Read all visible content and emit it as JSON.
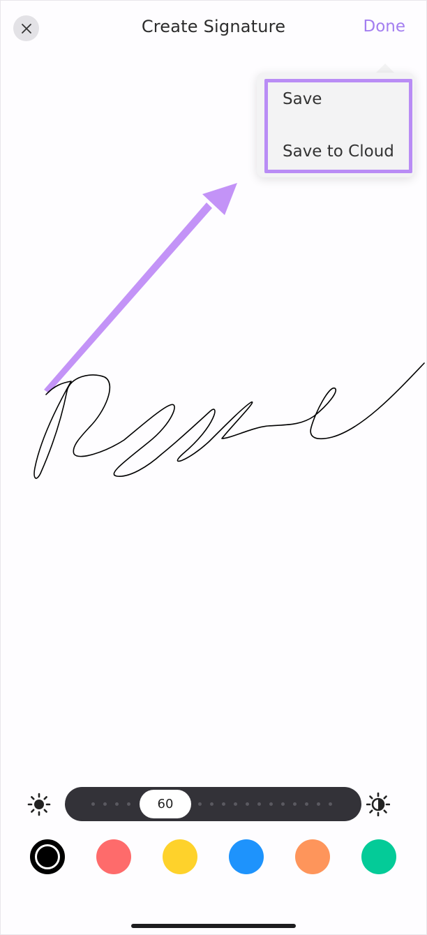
{
  "header": {
    "title": "Create Signature",
    "done_label": "Done",
    "close_icon": "close-icon"
  },
  "dropdown": {
    "items": [
      {
        "label": "Save"
      },
      {
        "label": "Save to Cloud"
      }
    ],
    "highlight_color": "#b98cf5"
  },
  "annotation": {
    "arrow_color": "#c393f7",
    "arrow_icon": "arrow-annotation"
  },
  "canvas": {
    "ink_color": "#000000"
  },
  "slider": {
    "value": "60",
    "min_icon": "brightness-low-icon",
    "max_icon": "brightness-high-icon"
  },
  "colors": {
    "accent": "#a37ef0",
    "swatches": [
      {
        "name": "black",
        "hex": "#000000",
        "selected": true
      },
      {
        "name": "red",
        "hex": "#fe6b6b",
        "selected": false
      },
      {
        "name": "yellow",
        "hex": "#fed22b",
        "selected": false
      },
      {
        "name": "blue",
        "hex": "#1e93fc",
        "selected": false
      },
      {
        "name": "orange",
        "hex": "#fe955b",
        "selected": false
      },
      {
        "name": "green",
        "hex": "#04cb98",
        "selected": false
      }
    ]
  }
}
